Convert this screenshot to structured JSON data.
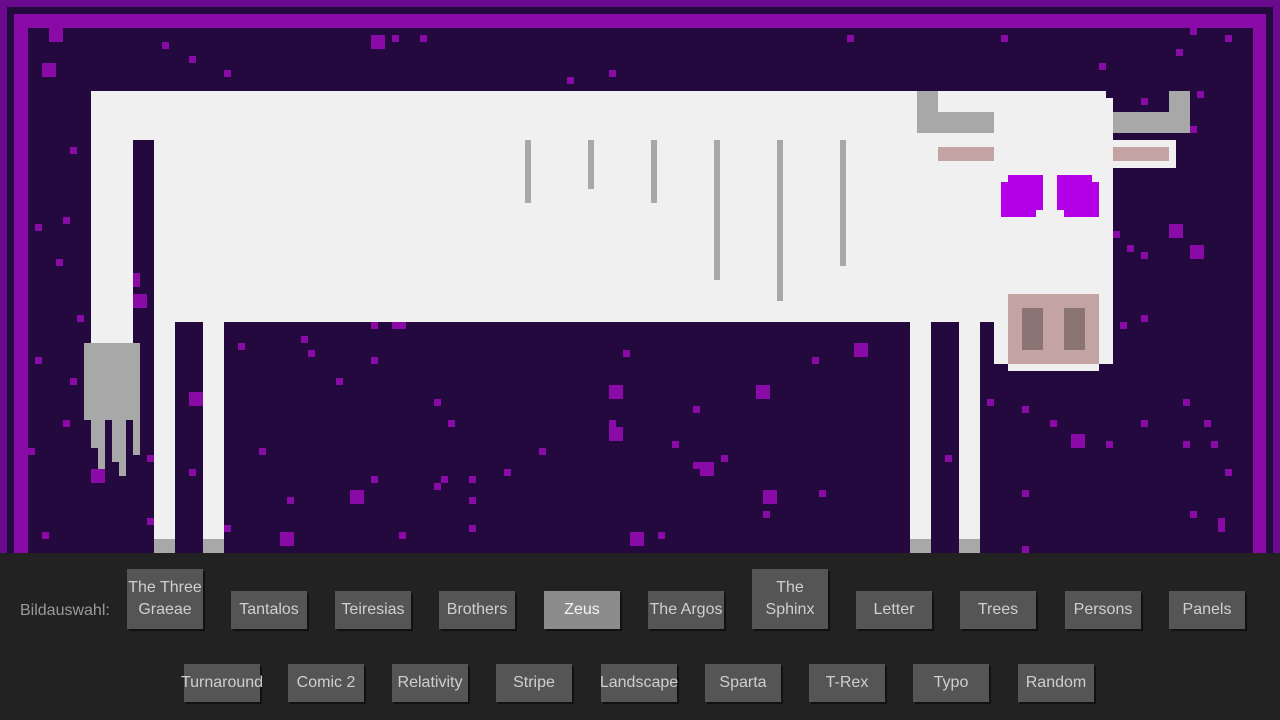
{
  "selector": {
    "label": "Bildauswahl:",
    "active": "Zeus",
    "row1": [
      "The Three Graeae",
      "Tantalos",
      "Teiresias",
      "Brothers",
      "Zeus",
      "The Argos",
      "The Sphinx",
      "Letter",
      "Trees",
      "Persons",
      "Panels"
    ],
    "row2": [
      "Turnaround",
      "Comic 2",
      "Relativity",
      "Stripe",
      "Landscape",
      "Sparta",
      "T-Rex",
      "Typo",
      "Random"
    ]
  },
  "colors": {
    "background_dark": "#24093f",
    "frame_purple": "#8a0aa8",
    "bull_white": "#f0f0f0",
    "accent_grey": "#a8a8a8",
    "eye_magenta": "#b300e6",
    "snout_pink": "#c4a3a3"
  },
  "artwork": {
    "subject": "pixel-art-white-bull"
  }
}
